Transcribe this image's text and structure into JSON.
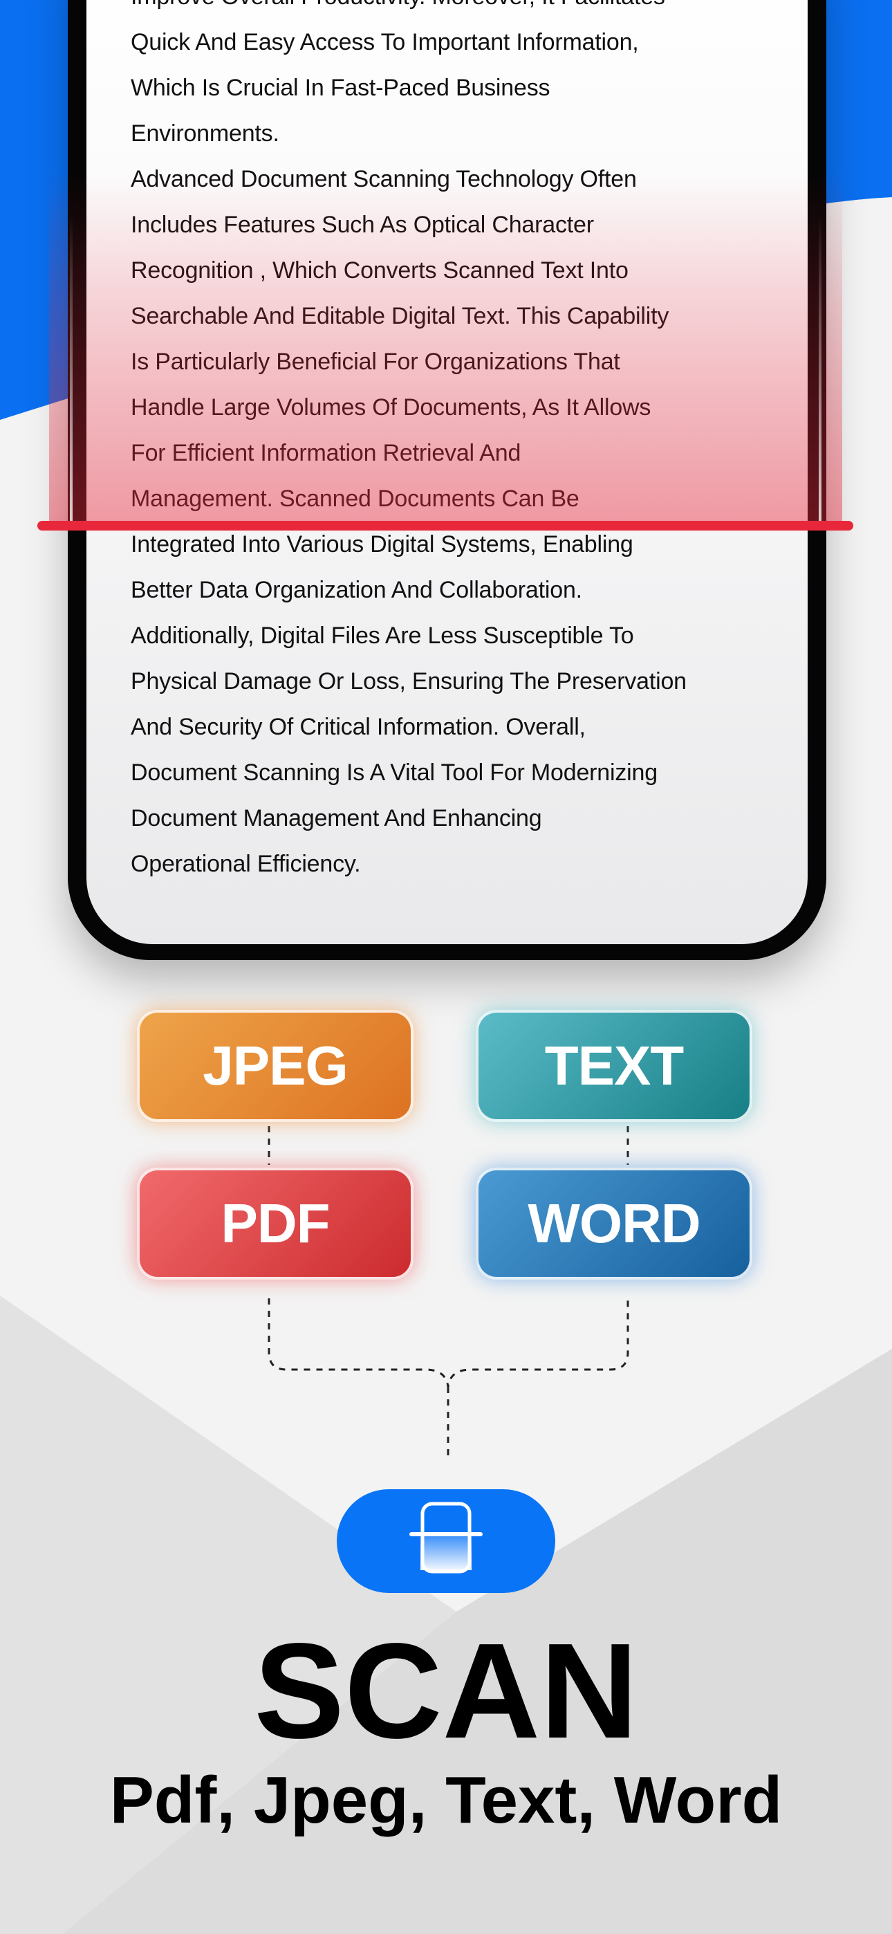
{
  "document": {
    "lines": [
      "Improve Overall Productivity. Moreover, It Facilitates",
      "Quick And Easy Access To Important Information,",
      "Which Is Crucial In Fast-Paced Business",
      "Environments.",
      "Advanced Document Scanning Technology Often",
      "Includes Features Such As Optical Character",
      "Recognition , Which Converts Scanned Text Into",
      "Searchable And Editable Digital Text. This Capability",
      "Is Particularly Beneficial For Organizations That",
      "Handle Large Volumes Of Documents, As It Allows",
      "For Efficient Information Retrieval And",
      "Management. Scanned Documents Can Be",
      "Integrated Into Various Digital Systems, Enabling",
      "Better Data Organization And Collaboration.",
      "Additionally, Digital Files Are Less Susceptible To",
      "Physical Damage Or Loss, Ensuring The Preservation",
      "And Security Of Critical Information. Overall,",
      "Document Scanning Is A Vital Tool For Modernizing",
      "Document Management And Enhancing",
      "Operational Efficiency."
    ]
  },
  "formats": {
    "jpeg": "JPEG",
    "text": "TEXT",
    "pdf": "PDF",
    "word": "WORD"
  },
  "scan_button": {
    "icon": "scan-icon"
  },
  "title": "SCAN",
  "subtitle": "Pdf, Jpeg, Text, Word",
  "colors": {
    "brand_blue": "#0a74f7",
    "scan_line": "#e8283a",
    "jpeg": "#e98a35",
    "text": "#2a9ea6",
    "pdf": "#e0474a",
    "word": "#2f7fc0"
  }
}
